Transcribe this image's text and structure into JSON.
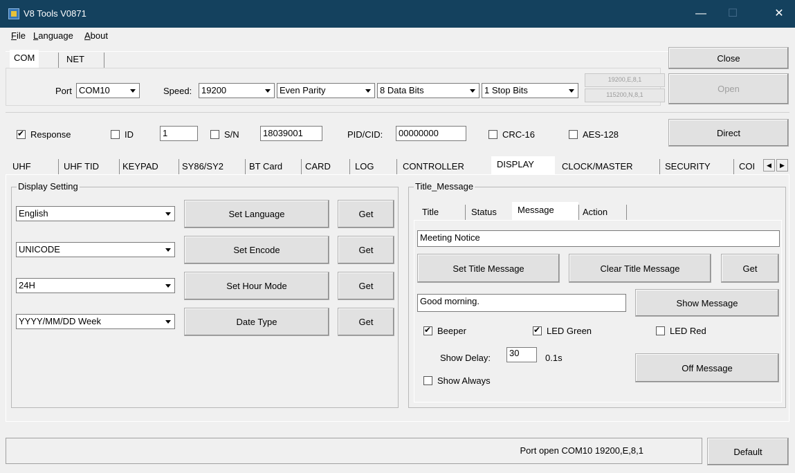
{
  "window": {
    "title": "V8 Tools V0871",
    "minimize": "—",
    "maximize": "☐",
    "close": "✕"
  },
  "menu": {
    "file": "File",
    "language": "Language",
    "about": "About"
  },
  "conn_tabs": {
    "com": "COM",
    "net": "NET"
  },
  "conn": {
    "port_label": "Port",
    "port_value": "COM10",
    "speed_label": "Speed:",
    "speed_value": "19200",
    "parity_value": "Even Parity",
    "databits_value": "8 Data Bits",
    "stopbits_value": "1 Stop Bits",
    "preset1": "19200,E,8,1",
    "preset2": "115200,N,8,1",
    "close_btn": "Close",
    "open_btn": "Open"
  },
  "options": {
    "response_label": "Response",
    "response_checked": true,
    "id_label": "ID",
    "id_checked": false,
    "id_value": "1",
    "sn_label": "S/N",
    "sn_checked": false,
    "sn_value": "18039001",
    "pid_label": "PID/CID:",
    "pid_value": "00000000",
    "crc_label": "CRC-16",
    "aes_label": "AES-128",
    "direct_btn": "Direct"
  },
  "main_tabs": [
    "UHF",
    "UHF TID",
    "KEYPAD",
    "SY86/SY2",
    "BT Card",
    "CARD",
    "LOG",
    "CONTROLLER",
    "DISPLAY",
    "CLOCK/MASTER",
    "SECURITY",
    "COI"
  ],
  "display_setting": {
    "title": "Display Setting",
    "rows": [
      {
        "select": "English",
        "set": "Set Language",
        "get": "Get"
      },
      {
        "select": "UNICODE",
        "set": "Set Encode",
        "get": "Get"
      },
      {
        "select": "24H",
        "set": "Set Hour Mode",
        "get": "Get"
      },
      {
        "select": "YYYY/MM/DD Week",
        "set": "Date Type",
        "get": "Get"
      }
    ]
  },
  "title_message": {
    "title": "Title_Message",
    "tabs": [
      "Title",
      "Status",
      "Message",
      "Action"
    ],
    "title_value": "Meeting Notice",
    "set_title_btn": "Set Title Message",
    "clear_title_btn": "Clear Title Message",
    "get_btn": "Get",
    "message_value": "Good morning.",
    "show_message_btn": "Show Message",
    "beeper_label": "Beeper",
    "led_green_label": "LED Green",
    "led_red_label": "LED Red",
    "show_delay_label": "Show Delay:",
    "show_delay_value": "30",
    "show_delay_unit": "0.1s",
    "show_always_label": "Show Always",
    "off_message_btn": "Off Message"
  },
  "status": {
    "text": "Port open COM10 19200,E,8,1",
    "default_btn": "Default"
  }
}
